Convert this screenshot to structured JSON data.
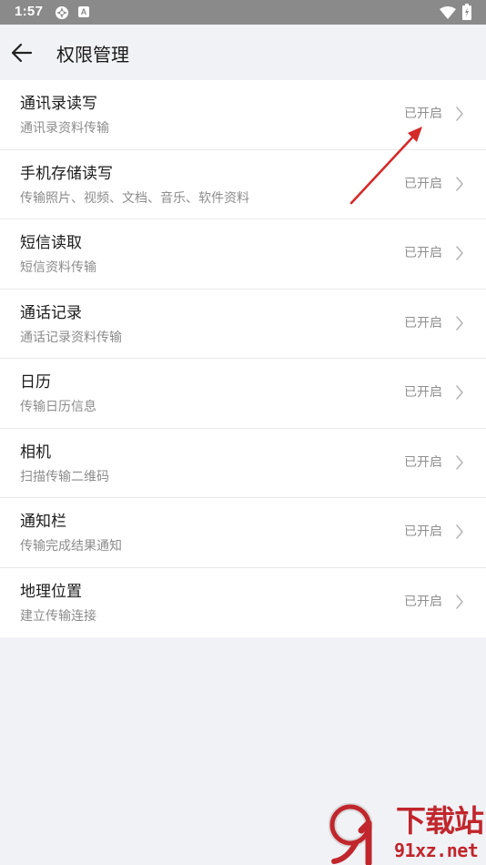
{
  "status_bar": {
    "time": "1:57",
    "icons": [
      "app-icon",
      "a-badge-icon",
      "wifi-icon",
      "battery-icon"
    ],
    "badge_letter": "A"
  },
  "header": {
    "title": "权限管理",
    "back_icon": "arrow-left-icon"
  },
  "permissions": [
    {
      "title": "通讯录读写",
      "subtitle": "通讯录资料传输",
      "status": "已开启"
    },
    {
      "title": "手机存储读写",
      "subtitle": "传输照片、视频、文档、音乐、软件资料",
      "status": "已开启"
    },
    {
      "title": "短信读取",
      "subtitle": "短信资料传输",
      "status": "已开启"
    },
    {
      "title": "通话记录",
      "subtitle": "通话记录资料传输",
      "status": "已开启"
    },
    {
      "title": "日历",
      "subtitle": "传输日历信息",
      "status": "已开启"
    },
    {
      "title": "相机",
      "subtitle": "扫描传输二维码",
      "status": "已开启"
    },
    {
      "title": "通知栏",
      "subtitle": "传输完成结果通知",
      "status": "已开启"
    },
    {
      "title": "地理位置",
      "subtitle": "建立传输连接",
      "status": "已开启"
    }
  ],
  "watermark": {
    "brand": "下载站",
    "url": "91xz.net"
  },
  "colors": {
    "background": "#f1f2f6",
    "status_bar": "#8a8a8a",
    "annotation_arrow": "#d42a2a",
    "watermark": "#c0262c"
  }
}
